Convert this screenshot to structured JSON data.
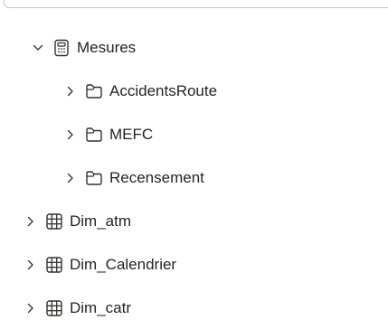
{
  "tree": {
    "measures_group": {
      "label": "Mesures",
      "expanded": true,
      "folders": [
        {
          "label": "AccidentsRoute"
        },
        {
          "label": "MEFC"
        },
        {
          "label": "Recensement"
        }
      ]
    },
    "tables": [
      {
        "label": "Dim_atm"
      },
      {
        "label": "Dim_Calendrier"
      },
      {
        "label": "Dim_catr"
      }
    ]
  },
  "colors": {
    "text": "#252423",
    "icon_stroke": "#323130",
    "border": "#c8c6c4"
  }
}
